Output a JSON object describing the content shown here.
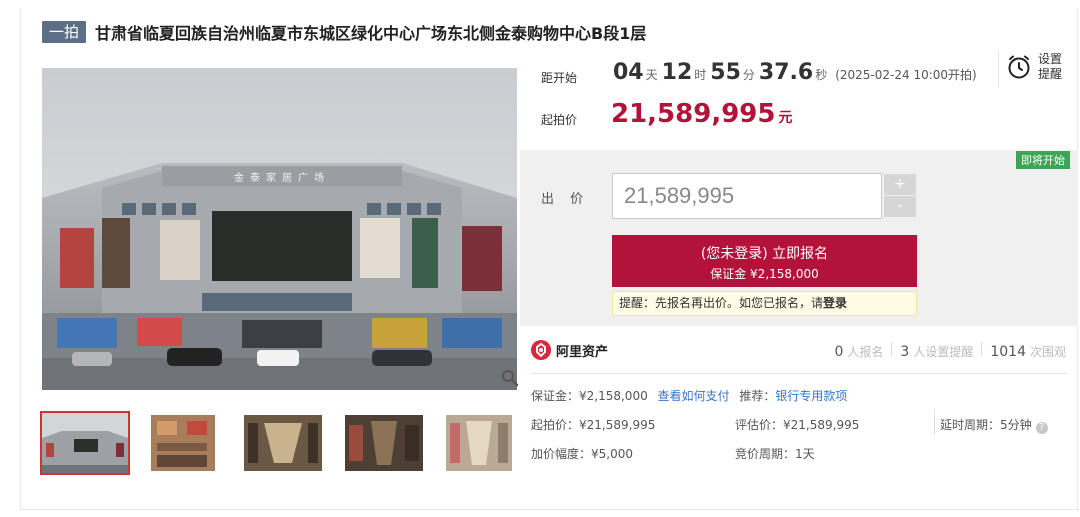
{
  "header": {
    "badge": "一拍",
    "title": "甘肃省临夏回族自治州临夏市东城区绿化中心广场东北侧金泰购物中心B段1层"
  },
  "building_sign": "金泰家居广场",
  "countdown": {
    "label": "距开始",
    "days": "04",
    "days_unit": "天",
    "hours": "12",
    "hours_unit": "时",
    "minutes": "55",
    "minutes_unit": "分",
    "seconds": "37.6",
    "seconds_unit": "秒",
    "start_time": "(2025-02-24 10:00开拍)"
  },
  "reminder": {
    "line1": "设置",
    "line2": "提醒",
    "icon": "alarm-clock-icon"
  },
  "start_price": {
    "label": "起拍价",
    "value": "21,589,995",
    "unit": "元"
  },
  "bid": {
    "status_badge": "即将开始",
    "label": "出 价",
    "input_value": "21,589,995",
    "plus": "+",
    "minus": "-",
    "signup_line1": "(您未登录) 立即报名",
    "signup_line2": "保证金 ¥2,158,000",
    "tip_text": "提醒：先报名再出价。如您已报名，请",
    "tip_login": "登录"
  },
  "platform": {
    "name": "阿里资产",
    "icon": "ali-assets-icon"
  },
  "stats": {
    "signups": "0",
    "signups_label": "人报名",
    "reminders": "3",
    "reminders_label": "人设置提醒",
    "views": "1014",
    "views_label": "次围观"
  },
  "details": {
    "deposit": "保证金：¥2,158,000",
    "how_to_pay": "查看如何支付",
    "recommend_label": "推荐：",
    "recommend_link": "银行专用款项",
    "start_price": "起拍价：¥21,589,995",
    "appraisal": "评估价：¥21,589,995",
    "delay_period": "延时周期：5分钟",
    "increment": "加价幅度：¥5,000",
    "auction_period": "竞价周期：1天"
  },
  "colors": {
    "accent": "#b3133b",
    "badge": "#5d6f86",
    "status_green": "#3ea556",
    "link": "#3a74c7"
  }
}
